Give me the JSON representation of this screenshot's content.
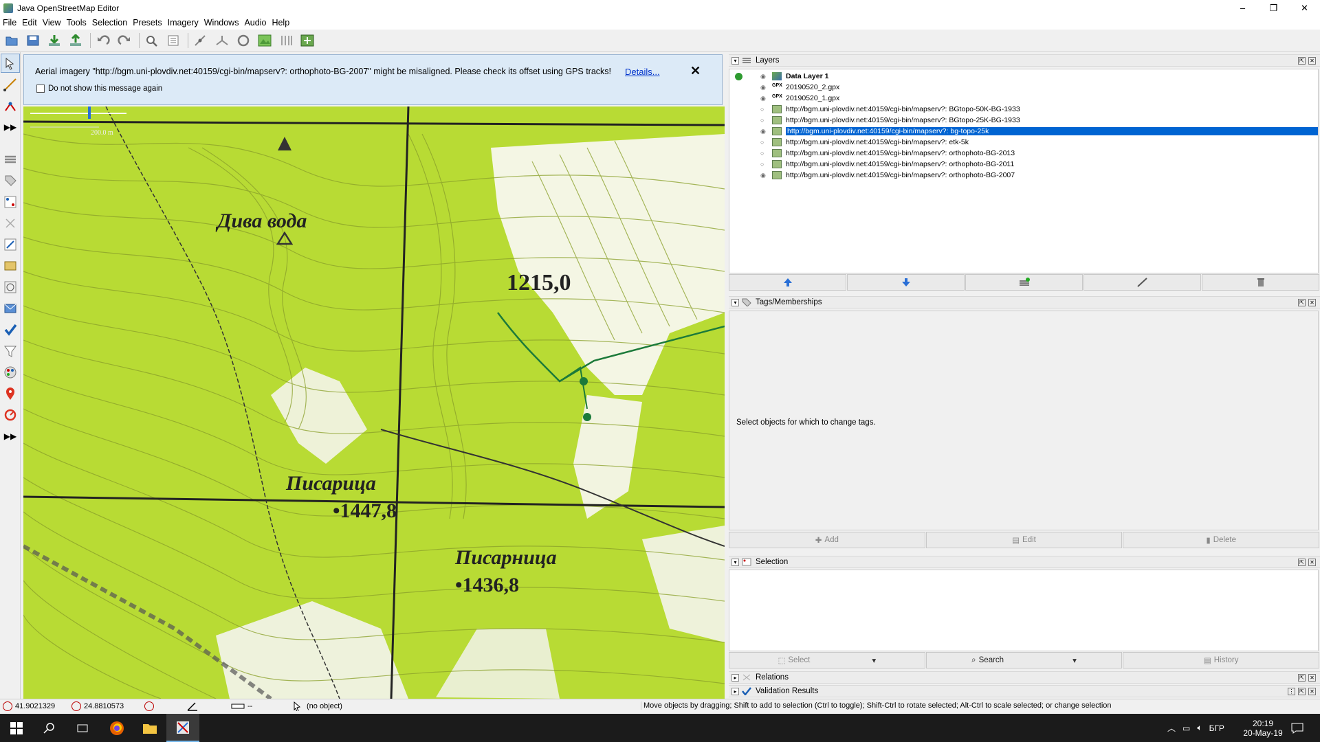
{
  "window": {
    "title": "Java OpenStreetMap Editor",
    "controls": [
      "–",
      "❐",
      "✕"
    ]
  },
  "menu": [
    "File",
    "Edit",
    "View",
    "Tools",
    "Selection",
    "Presets",
    "Imagery",
    "Windows",
    "Audio",
    "Help"
  ],
  "notification": {
    "message": "Aerial imagery \"http://bgm.uni-plovdiv.net:40159/cgi-bin/mapserv?: orthophoto-BG-2007\" might be misaligned. Please check its offset using GPS tracks!",
    "details_link": "Details...",
    "checkbox_label": "Do not show this message again",
    "close": "✕"
  },
  "map": {
    "scale_label": "200.0 m",
    "labels": [
      "Дива вода",
      "1215,0",
      "Писарица",
      "•1447,8",
      "Писарница",
      "•1436,8"
    ]
  },
  "layers_panel": {
    "title": "Layers",
    "layers": [
      {
        "name": "Data Layer 1",
        "type": "data",
        "active": true,
        "visible": true,
        "selected": false
      },
      {
        "name": "20190520_2.gpx",
        "type": "gpx",
        "active": false,
        "visible": true,
        "selected": false
      },
      {
        "name": "20190520_1.gpx",
        "type": "gpx",
        "active": false,
        "visible": true,
        "selected": false
      },
      {
        "name": "http://bgm.uni-plovdiv.net:40159/cgi-bin/mapserv?: BGtopo-50K-BG-1933",
        "type": "imagery",
        "active": false,
        "visible": false,
        "selected": false
      },
      {
        "name": "http://bgm.uni-plovdiv.net:40159/cgi-bin/mapserv?: BGtopo-25K-BG-1933",
        "type": "imagery",
        "active": false,
        "visible": false,
        "selected": false
      },
      {
        "name": "http://bgm.uni-plovdiv.net:40159/cgi-bin/mapserv?: bg-topo-25k",
        "type": "imagery",
        "active": false,
        "visible": true,
        "selected": true
      },
      {
        "name": "http://bgm.uni-plovdiv.net:40159/cgi-bin/mapserv?: etk-5k",
        "type": "imagery",
        "active": false,
        "visible": false,
        "selected": false
      },
      {
        "name": "http://bgm.uni-plovdiv.net:40159/cgi-bin/mapserv?: orthophoto-BG-2013",
        "type": "imagery",
        "active": false,
        "visible": false,
        "selected": false
      },
      {
        "name": "http://bgm.uni-plovdiv.net:40159/cgi-bin/mapserv?: orthophoto-BG-2011",
        "type": "imagery",
        "active": false,
        "visible": false,
        "selected": false
      },
      {
        "name": "http://bgm.uni-plovdiv.net:40159/cgi-bin/mapserv?: orthophoto-BG-2007",
        "type": "imagery",
        "active": false,
        "visible": true,
        "selected": false
      }
    ]
  },
  "tags_panel": {
    "title": "Tags/Memberships",
    "hint": "Select objects for which to change tags.",
    "buttons": {
      "add": "Add",
      "edit": "Edit",
      "delete": "Delete"
    }
  },
  "selection_panel": {
    "title": "Selection",
    "buttons": {
      "select": "Select",
      "search": "Search",
      "history": "History"
    }
  },
  "relations_panel": {
    "title": "Relations"
  },
  "validation_panel": {
    "title": "Validation Results"
  },
  "statusbar": {
    "lat": "41.9021329",
    "lon": "24.8810573",
    "heading": "",
    "angle": "",
    "distance": "--",
    "object": "(no object)",
    "help": "Move objects by dragging; Shift to add to selection (Ctrl to toggle); Shift-Ctrl to rotate selected; Alt-Ctrl to scale selected; or change selection"
  },
  "taskbar": {
    "time": "20:19",
    "date": "20-May-19",
    "language": "БГР"
  },
  "colors": {
    "map_green": "#b8db34",
    "selection_blue": "#0064d2",
    "notification_bg": "#dceaf7"
  }
}
